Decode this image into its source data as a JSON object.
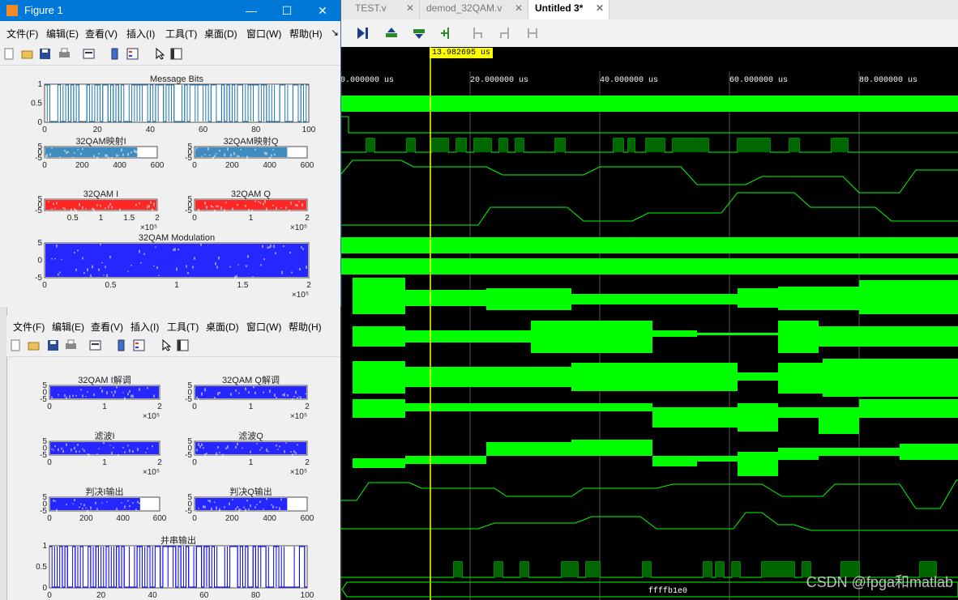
{
  "wave": {
    "tabs": [
      {
        "label": "TEST.v",
        "active": false
      },
      {
        "label": "demod_32QAM.v",
        "active": false
      },
      {
        "label": "Untitled 3*",
        "active": true
      }
    ],
    "toolbar_icons": [
      "go-to-start-icon",
      "swap-up-icon",
      "swap-down-icon",
      "add-marker-icon",
      "prev-edge-icon",
      "next-edge-icon",
      "fit-icon"
    ],
    "cursor_time": "13.982695 us",
    "time_ticks": [
      "0.000000 us",
      "20.000000 us",
      "40.000000 us",
      "60.000000 us",
      "80.000000 us"
    ],
    "bus_value": "ffffb1e0",
    "colors": {
      "signal": "#00ff00",
      "cursor": "#ffff00",
      "background": "#000000",
      "grid": "#555555"
    },
    "watermark": "CSDN @fpga和matlab"
  },
  "figure1": {
    "title": "Figure 1",
    "window_controls": [
      "—",
      "☐",
      "✕"
    ],
    "menu": [
      "文件(F)",
      "编辑(E)",
      "查看(V)",
      "插入(I)",
      "工具(T)",
      "桌面(D)",
      "窗口(W)",
      "帮助(H)",
      "↘"
    ],
    "plots": [
      {
        "title": "Message Bits",
        "yticks": [
          "1",
          "0.5",
          "0"
        ],
        "xticks": [
          "0",
          "20",
          "40",
          "60",
          "80",
          "100"
        ]
      },
      {
        "title": "32QAM映射I",
        "yticks": [
          "5",
          "0",
          "-5"
        ],
        "xticks": [
          "0",
          "200",
          "400",
          "600"
        ]
      },
      {
        "title": "32QAM映射Q",
        "yticks": [
          "5",
          "0",
          "-5"
        ],
        "xticks": [
          "0",
          "200",
          "400",
          "600"
        ]
      },
      {
        "title": "32QAM I",
        "yticks": [
          "5",
          "0",
          "-5"
        ],
        "xticks": [
          "0.5",
          "1",
          "1.5",
          "2"
        ],
        "exponent": "×10⁵"
      },
      {
        "title": "32QAM Q",
        "yticks": [
          "5",
          "0",
          "-5"
        ],
        "xticks": [
          "0",
          "1",
          "2"
        ],
        "exponent": "×10⁵"
      },
      {
        "title": "32QAM Modulation",
        "yticks": [
          "5",
          "0",
          "-5"
        ],
        "xticks": [
          "0",
          "0.5",
          "1",
          "1.5",
          "2"
        ],
        "exponent": "×10⁵"
      }
    ]
  },
  "figure2": {
    "menu": [
      "文件(F)",
      "编辑(E)",
      "查看(V)",
      "插入(I)",
      "工具(T)",
      "桌面(D)",
      "窗口(W)",
      "帮助(H)"
    ],
    "plots": [
      {
        "title": "32QAM I解调",
        "yticks": [
          "5",
          "0",
          "-5"
        ],
        "xticks": [
          "0",
          "1",
          "2"
        ],
        "exponent": "×10⁵"
      },
      {
        "title": "32QAM Q解调",
        "yticks": [
          "5",
          "0",
          "-5"
        ],
        "xticks": [
          "0",
          "1",
          "2"
        ],
        "exponent": "×10⁵"
      },
      {
        "title": "滤波I",
        "yticks": [
          "5",
          "0",
          "-5"
        ],
        "xticks": [
          "0",
          "1",
          "2"
        ],
        "exponent": "×10⁵"
      },
      {
        "title": "滤波Q",
        "yticks": [
          "5",
          "0",
          "-5"
        ],
        "xticks": [
          "0",
          "1",
          "2"
        ],
        "exponent": "×10⁵"
      },
      {
        "title": "判决I输出",
        "yticks": [
          "5",
          "0",
          "-5"
        ],
        "xticks": [
          "0",
          "200",
          "400",
          "600"
        ]
      },
      {
        "title": "判决Q输出",
        "yticks": [
          "5",
          "0",
          "-5"
        ],
        "xticks": [
          "0",
          "200",
          "400",
          "600"
        ]
      },
      {
        "title": "并串输出",
        "yticks": [
          "1",
          "0.5",
          "0"
        ],
        "xticks": [
          "0",
          "20",
          "40",
          "60",
          "80",
          "100"
        ]
      }
    ]
  }
}
